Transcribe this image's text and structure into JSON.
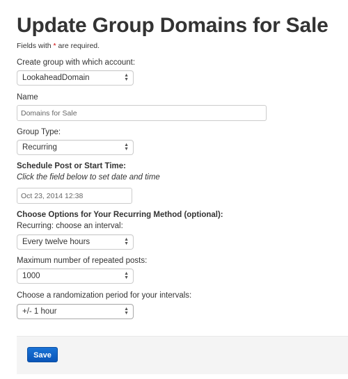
{
  "title": "Update Group Domains for Sale",
  "required_note": {
    "before": "Fields with ",
    "star": "*",
    "after": " are required."
  },
  "account": {
    "label": "Create group with which account:",
    "value": "LookaheadDomain"
  },
  "name": {
    "label": "Name",
    "value": "Domains for Sale"
  },
  "group_type": {
    "label": "Group Type:",
    "value": "Recurring"
  },
  "schedule": {
    "label": "Schedule Post or Start Time:",
    "hint": "Click the field below to set date and time",
    "value": "Oct 23, 2014 12:38"
  },
  "recurring": {
    "heading": "Choose Options for Your Recurring Method (optional):",
    "interval_label": "Recurring: choose an interval:",
    "interval_value": "Every twelve hours",
    "max_label": "Maximum number of repeated posts:",
    "max_value": "1000",
    "random_label": "Choose a randomization period for your intervals:",
    "random_value": "+/- 1 hour"
  },
  "save_label": "Save"
}
